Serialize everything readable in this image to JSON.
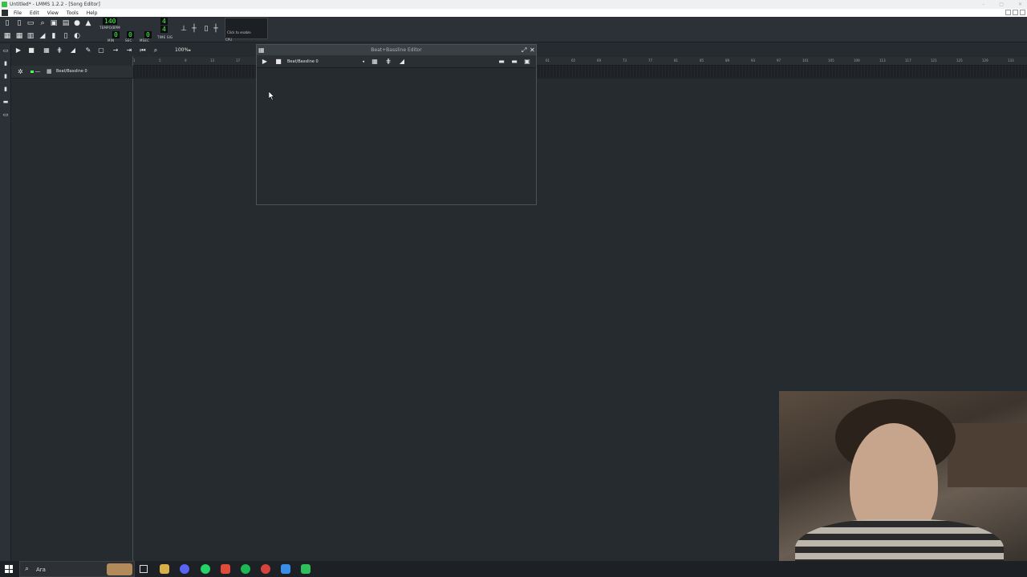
{
  "window": {
    "title": "Untitled* - LMMS 1.2.2 - [Song Editor]"
  },
  "menu": {
    "items": [
      "File",
      "Edit",
      "View",
      "Tools",
      "Help"
    ]
  },
  "toolbar": {
    "tempo_value": "140",
    "tempo_label": "TEMPO/BPM",
    "min_value": "0",
    "sec_value": "0",
    "msec_value": "0",
    "min_label": "MIN",
    "sec_label": "SEC",
    "msec_label": "MSEC",
    "timesig_num": "4",
    "timesig_den": "4",
    "timesig_label": "TIME SIG",
    "cpu_hint": "Click to enable",
    "cpu_label": "CPU"
  },
  "song_editor": {
    "zoom": "100%",
    "ruler_ticks": [
      "1",
      "5",
      "9",
      "13",
      "17",
      "61",
      "65",
      "69",
      "73",
      "77",
      "81",
      "85",
      "89",
      "93",
      "97",
      "101",
      "105",
      "109",
      "113",
      "117",
      "121",
      "125",
      "129",
      "133",
      "137"
    ],
    "tracks": [
      {
        "name": "Beat/Bassline 0"
      }
    ]
  },
  "bb_editor": {
    "title": "Beat+Bassline Editor",
    "selected": "Beat/Bassline 0"
  },
  "taskbar": {
    "search_placeholder": "Ara",
    "icon_colors": [
      "#d8b04a",
      "#5865f2",
      "#25d366",
      "#e04b3a",
      "#1db954",
      "#d6453d",
      "#3a8ee6",
      "#2fbf5b"
    ]
  }
}
